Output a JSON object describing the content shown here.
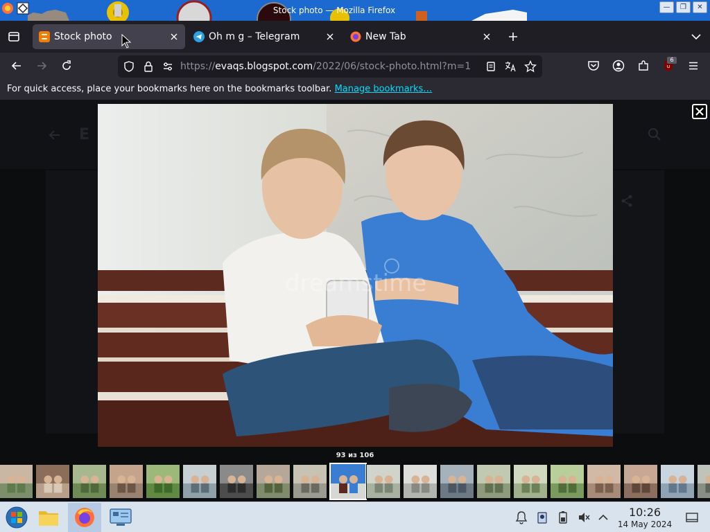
{
  "window": {
    "title": "Stock photo — Mozilla Firefox",
    "controls": {
      "minimize": "—",
      "maximize": "❐",
      "close": "✕"
    }
  },
  "tabs": [
    {
      "label": "Stock photo",
      "favicon": "blogger-icon",
      "active": true
    },
    {
      "label": "Oh m g – Telegram",
      "favicon": "telegram-icon",
      "active": false
    },
    {
      "label": "New Tab",
      "favicon": "firefox-icon",
      "active": false
    }
  ],
  "toolbar": {
    "url_prefix": "https://",
    "url_host": "evaqs.blogspot.com",
    "url_path": "/2022/06/stock-photo.html?m=1",
    "extension_badge": "6"
  },
  "bookmarks_bar": {
    "message": "For quick access, place your bookmarks here on the bookmarks toolbar.",
    "link": "Manage bookmarks…"
  },
  "lightbox": {
    "counter": "93 из 106",
    "watermark": "dreamstime",
    "active_thumbnail_index": 9,
    "thumbnail_count": 20
  },
  "taskbar": {
    "time": "10:26",
    "date": "14 May 2024"
  },
  "colors": {
    "accent": "#1c6ad0",
    "tab_strip": "#1f1e25",
    "toolbar": "#2b2a33",
    "link": "#00ddff",
    "shirt_blue": "#3a7ed4"
  }
}
